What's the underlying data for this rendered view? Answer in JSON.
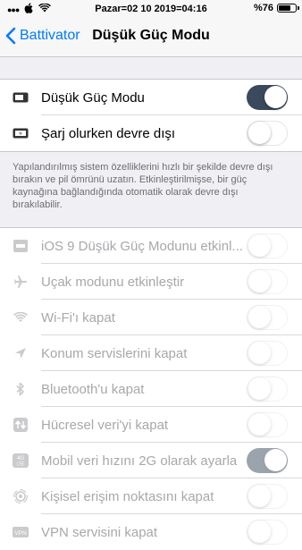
{
  "status_bar": {
    "datetime": "Pazar=02 10 2019=04:16",
    "battery_percent": "%76",
    "battery_level": 0.76
  },
  "nav": {
    "back_label": "Battivator",
    "title": "Düşük Güç Modu"
  },
  "main_group": [
    {
      "label": "Düşük Güç Modu",
      "icon": "battery-icon",
      "on": true
    },
    {
      "label": "Şarj olurken devre dışı",
      "icon": "charging-icon",
      "on": false
    }
  ],
  "footer_text": "Yapılandırılmış sistem özelliklerini hızlı bir şekilde devre dışı bırakın ve pil ömrünü uzatın. Etkinleştirilmişse, bir güç kaynağına bağlandığında otomatik olarak devre dışı bırakılabilir.",
  "options": [
    {
      "label": "iOS 9 Düşük Güç Modunu etkinl...",
      "icon": "battery-mode-icon",
      "on": false
    },
    {
      "label": "Uçak modunu etkinleştir",
      "icon": "airplane-icon",
      "on": false
    },
    {
      "label": "Wi-Fi'ı kapat",
      "icon": "wifi-icon",
      "on": false
    },
    {
      "label": "Konum servislerini kapat",
      "icon": "location-icon",
      "on": false
    },
    {
      "label": "Bluetooth'u kapat",
      "icon": "bluetooth-icon",
      "on": false
    },
    {
      "label": "Hücresel veri'yi kapat",
      "icon": "cellular-icon",
      "on": false
    },
    {
      "label": "Mobil veri hızını 2G olarak ayarla",
      "icon": "lte-icon",
      "on": true
    },
    {
      "label": "Kişisel erişim noktasını kapat",
      "icon": "hotspot-icon",
      "on": false
    },
    {
      "label": "VPN servisini kapat",
      "icon": "vpn-icon",
      "on": false
    }
  ]
}
